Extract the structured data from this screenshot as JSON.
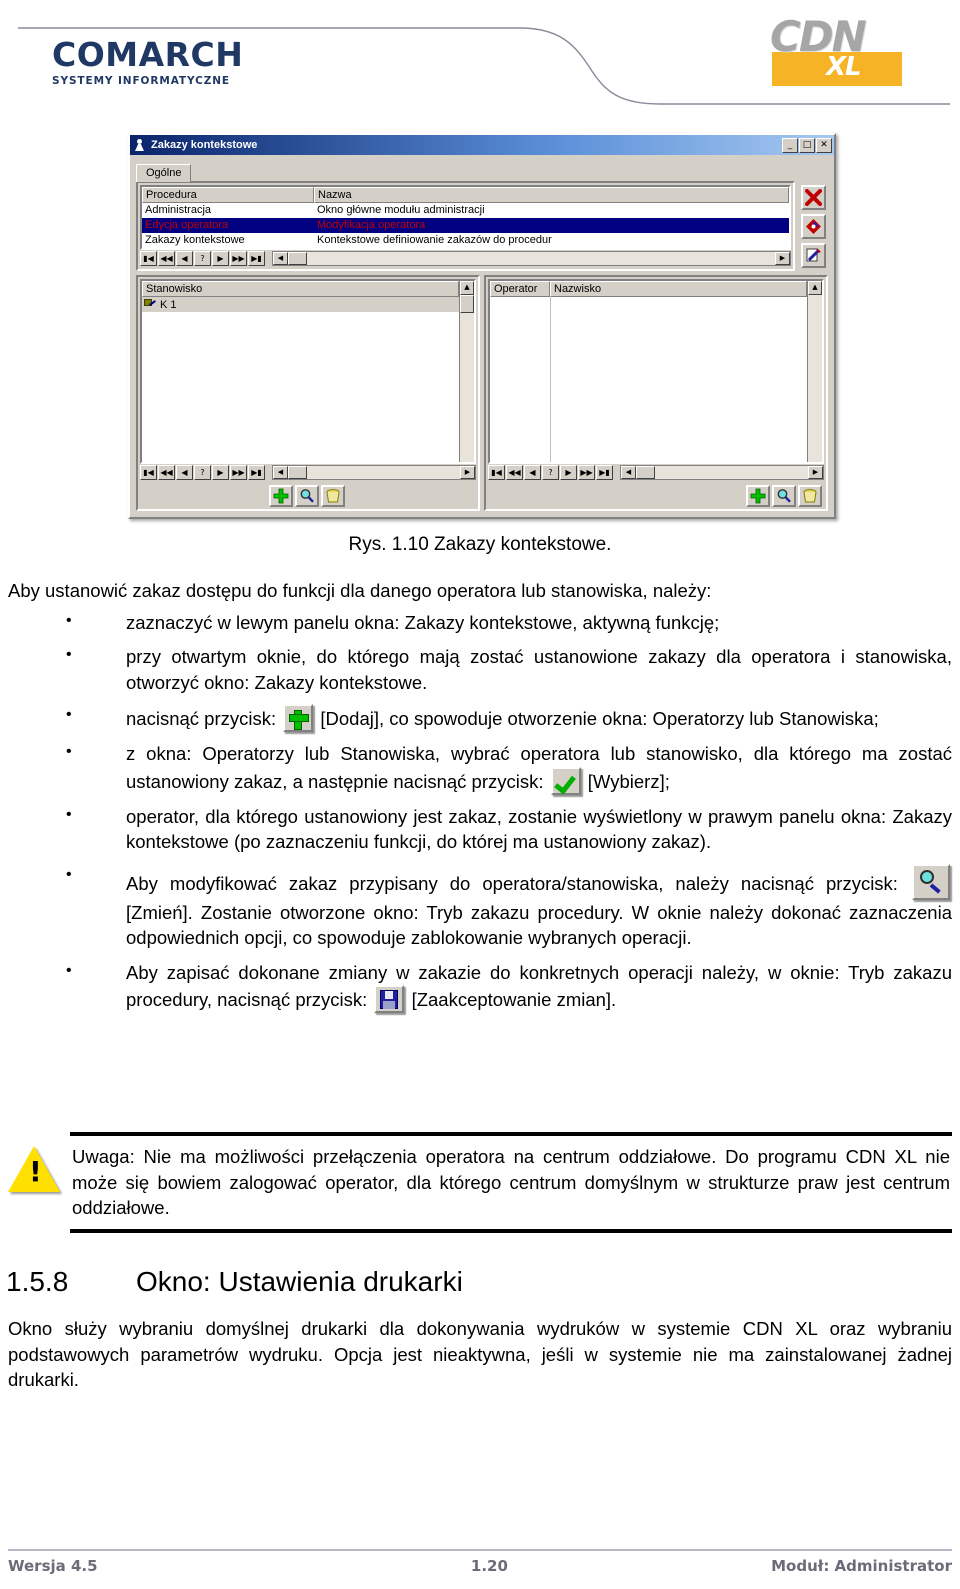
{
  "header": {
    "brand_name": "COMARCH",
    "brand_tagline": "SYSTEMY INFORMATYCZNE",
    "product_mark": "CDN",
    "product_edition": "XL",
    "brand_color": "#1F3864",
    "accent_color": "#F5B325"
  },
  "screenshot": {
    "window_title": "Zakazy kontekstowe",
    "window_buttons": {
      "minimize": "_",
      "maximize": "□",
      "close": "✕"
    },
    "tab": "Ogólne",
    "procedure_grid": {
      "columns": [
        "Procedura",
        "Nazwa"
      ],
      "rows": [
        {
          "procedura": "Administracja",
          "nazwa": "Okno główne modułu administracji",
          "selected": false
        },
        {
          "procedura": "Edycja operatora",
          "nazwa": "Modyfikacja operatora",
          "selected": true
        },
        {
          "procedura": "Zakazy kontekstowe",
          "nazwa": "Kontekstowe definiowanie zakazów do procedur",
          "selected": false
        }
      ]
    },
    "nav_buttons": [
      "▮◀",
      "◀◀",
      "◀",
      "?",
      "▶",
      "▶▶",
      "▶▮"
    ],
    "right_toolbar": [
      {
        "name": "close-record",
        "glyph": "✖",
        "color": "#c00000"
      },
      {
        "name": "change-record",
        "glyph": "◆",
        "color": "#c00000"
      },
      {
        "name": "report-record",
        "glyph": "✎",
        "color": "#2020a0"
      }
    ],
    "stanowisko_panel": {
      "column": "Stanowisko",
      "rows": [
        "K 1"
      ],
      "toolbar": [
        "add-icon",
        "edit-icon",
        "delete-icon"
      ]
    },
    "operator_panel": {
      "columns": [
        "Operator",
        "Nazwisko"
      ],
      "rows": [],
      "toolbar": [
        "add-icon",
        "edit-icon",
        "delete-icon"
      ]
    }
  },
  "figure": {
    "caption": "Rys. 1.10 Zakazy kontekstowe."
  },
  "content": {
    "intro": "Aby ustanowić zakaz dostępu do funkcji dla danego operatora lub stanowiska, należy:",
    "bullets": [
      {
        "id": "b1",
        "text_before": "zaznaczyć w lewym panelu okna: Zakazy kontekstowe, aktywną funkcję;",
        "icon": null,
        "text_after": ""
      },
      {
        "id": "b2",
        "text_before": "przy otwartym oknie, do którego mają zostać ustanowione zakazy dla operatora i stanowiska, otworzyć okno: Zakazy kontekstowe.",
        "icon": null,
        "text_after": ""
      },
      {
        "id": "b3",
        "text_before": "nacisnąć przycisk:",
        "icon": "plus-icon",
        "text_after": "[Dodaj], co spowoduje otworzenie okna: Operatorzy lub Stanowiska;"
      },
      {
        "id": "b4",
        "text_before": "z okna: Operatorzy lub Stanowiska, wybrać operatora lub stanowisko, dla którego ma zostać ustanowiony zakaz, a następnie nacisnąć przycisk:",
        "icon": "check-icon",
        "text_after": "[Wybierz];"
      },
      {
        "id": "b5",
        "text_before": "operator, dla którego ustanowiony jest zakaz, zostanie wyświetlony w prawym panelu okna: Zakazy kontekstowe (po zaznaczeniu funkcji, do której ma ustanowiony zakaz).",
        "icon": null,
        "text_after": ""
      },
      {
        "id": "b6",
        "text_before": "Aby modyfikować zakaz przypisany do operatora/stanowiska, należy nacisnąć przycisk:",
        "icon": "magnifier-icon",
        "text_after": "[Zmień]. Zostanie otworzone okno: Tryb zakazu procedury. W oknie należy dokonać zaznaczenia odpowiednich opcji, co spowoduje zablokowanie wybranych operacji."
      },
      {
        "id": "b7",
        "text_before": "Aby zapisać dokonane zmiany w zakazie do konkretnych operacji należy, w oknie: Tryb zakazu procedury, nacisnąć przycisk:",
        "icon": "disk-icon",
        "text_after": "[Zaakceptowanie zmian]."
      }
    ],
    "note": {
      "icon": "warning-icon",
      "text": "Uwaga: Nie ma możliwości przełączenia operatora na centrum oddziałowe. Do programu CDN XL nie może się bowiem zalogować operator, dla którego centrum domyślnym w strukturze praw jest centrum oddziałowe."
    },
    "section": {
      "number": "1.5.8",
      "title": "Okno: Ustawienia drukarki",
      "paragraph": "Okno służy wybraniu domyślnej drukarki dla dokonywania wydruków w systemie CDN XL oraz wybraniu podstawowych parametrów wydruku. Opcja jest nieaktywna, jeśli w systemie nie ma zainstalowanej żadnej drukarki."
    }
  },
  "footer": {
    "version": "Wersja 4.5",
    "page": "1.20",
    "module": "Moduł: Administrator"
  }
}
